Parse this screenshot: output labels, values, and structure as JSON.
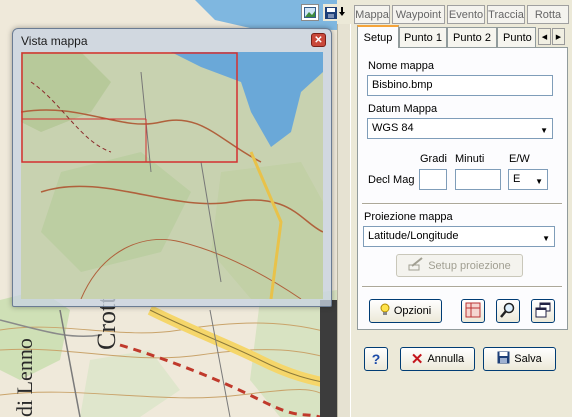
{
  "toolbar": {
    "image_icon": "image-icon",
    "save_icon": "save-dropdown-icon",
    "tabs": [
      "Mappa",
      "Waypoint",
      "Evento",
      "Traccia",
      "Rotta"
    ]
  },
  "panel_tabs": [
    "Setup",
    "Punto 1",
    "Punto 2",
    "Punto"
  ],
  "setup": {
    "map_name_label": "Nome mappa",
    "map_name_value": "Bisbino.bmp",
    "datum_label": "Datum Mappa",
    "datum_value": "WGS 84",
    "gradi_label": "Gradi",
    "minuti_label": "Minuti",
    "ew_label": "E/W",
    "decl_label": "Decl Mag",
    "gradi_value": "",
    "minuti_value": "",
    "ew_value": "E",
    "projection_label": "Proiezione mappa",
    "projection_value": "Latitude/Longitude",
    "setup_projection_button": "Setup proiezione",
    "options_button": "Opzioni"
  },
  "footer": {
    "cancel_button": "Annulla",
    "save_button": "Salva"
  },
  "map_window": {
    "title": "Vista mappa"
  },
  "map_labels": {
    "crotto": "Crott",
    "lenno": "di Lenno"
  },
  "colors": {
    "tab_highlight": "#f5a43a",
    "water": "#6aa8d8",
    "road_dash": "#c0392b",
    "window_close": "#c9483a"
  }
}
